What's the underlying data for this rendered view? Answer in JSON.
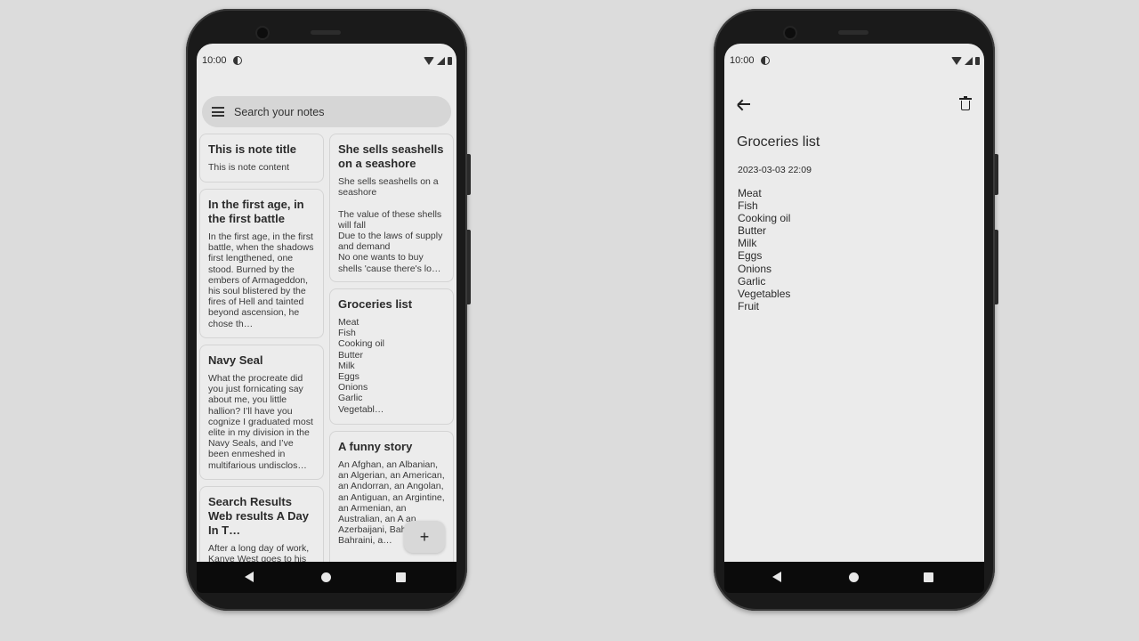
{
  "status_bar": {
    "time": "10:00"
  },
  "list_screen": {
    "search": {
      "placeholder": "Search your notes"
    },
    "left_column": [
      {
        "title": "This is note title",
        "content": "This is note content"
      },
      {
        "title": "In the first age, in the first battle",
        "content": "In the first age, in the first battle, when the shadows first lengthened, one stood. Burned by the embers of Armageddon, his soul blistered by the fires of Hell and tainted beyond ascension, he chose th…"
      },
      {
        "title": "Navy Seal",
        "content": "What the procreate did you just fornicating say about me, you little hallion? I’ll have you cognize I graduated most elite in my division in the Navy Seals, and I’ve been enmeshed in multifarious undisclos…"
      },
      {
        "title": "Search Results Web results A Day In T…",
        "content": "After a long day of work, Kanye West goes to his Kanye Nest to take his"
      }
    ],
    "right_column": [
      {
        "title": "She sells seashells on a seashore",
        "content": "She sells seashells on a seashore\n\nThe value of these shells will fall\nDue to the laws of supply and demand\nNo one wants to buy shells 'cause there's lo…"
      },
      {
        "title": "Groceries list",
        "content": "Meat\nFish\nCooking oil\nButter\nMilk\nEggs\nOnions\nGarlic\nVegetabl…"
      },
      {
        "title": "A funny story",
        "content": "An Afghan, an Albanian, an Algerian, an American, an Andorran, an Angolan,  an Antiguan, an Argintine, an Armenian, an Australian, an A an  Azerbaijani, Bahamian, a Bahraini, a…"
      }
    ],
    "fab_label": "+"
  },
  "detail_screen": {
    "title": "Groceries list",
    "date": "2023-03-03 22:09",
    "content": "Meat\nFish\nCooking oil\nButter\nMilk\nEggs\nOnions\nGarlic\nVegetables\nFruit"
  }
}
